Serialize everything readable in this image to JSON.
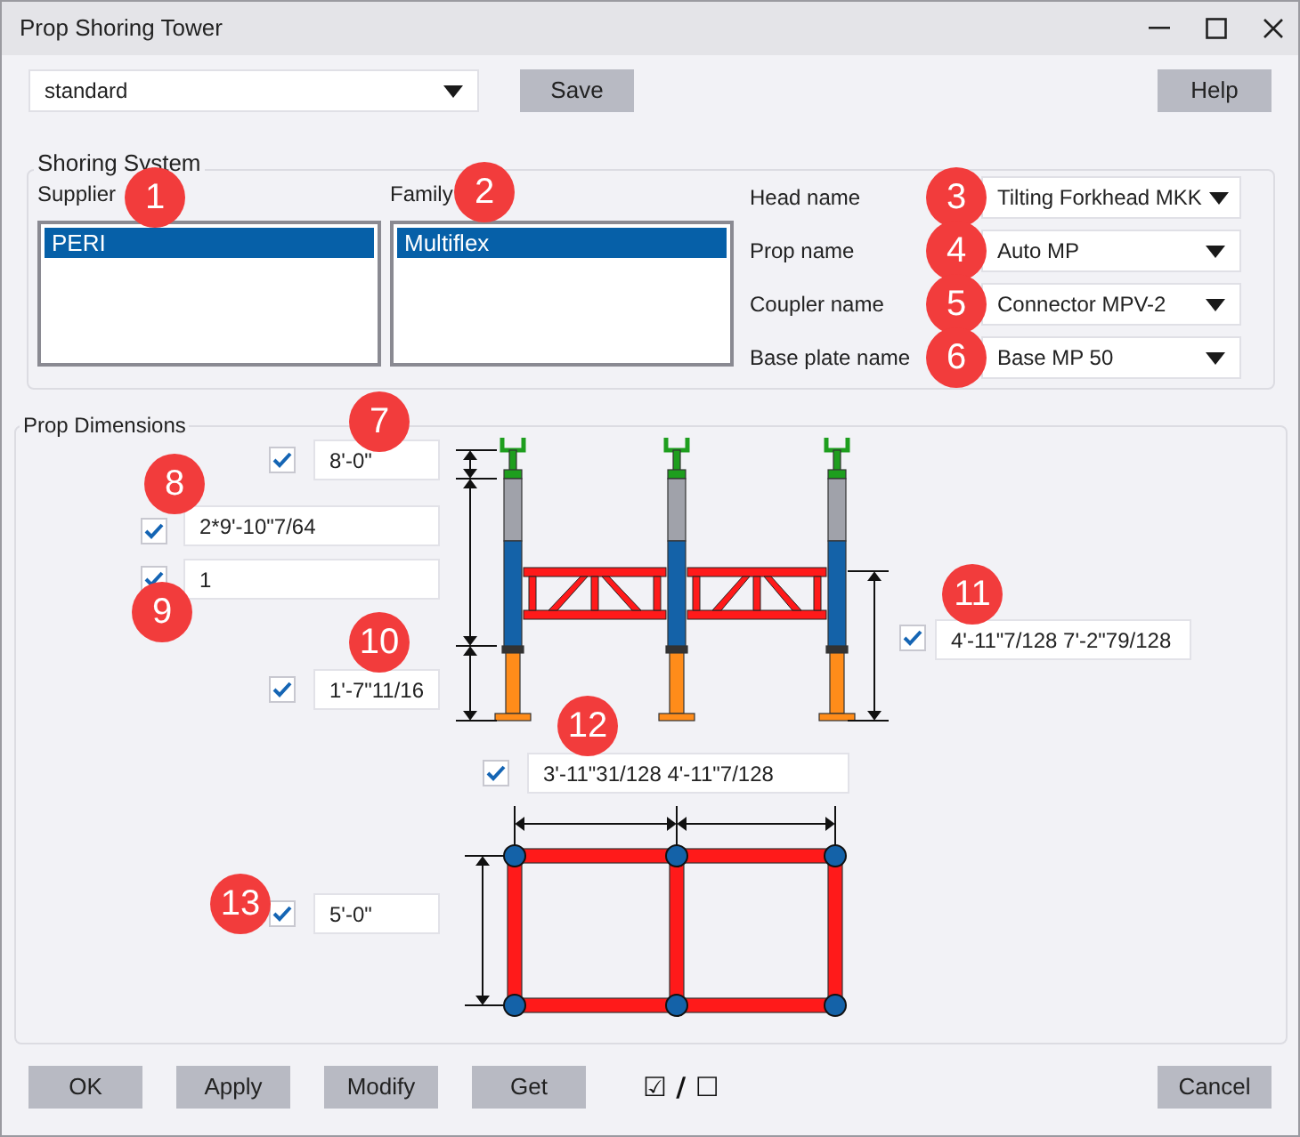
{
  "window": {
    "title": "Prop Shoring Tower"
  },
  "preset": {
    "value": "standard"
  },
  "top_buttons": [
    "Save",
    "Help"
  ],
  "shoring_system": {
    "label": "Shoring System",
    "lists": [
      {
        "label": "Supplier",
        "items": [
          {
            "text": "PERI",
            "selected": true
          }
        ]
      },
      {
        "label": "Family",
        "items": [
          {
            "text": "Multiflex",
            "selected": true
          }
        ]
      }
    ],
    "fields": [
      {
        "label": "Head name",
        "value": "Tilting Forkhead MKK"
      },
      {
        "label": "Prop name",
        "value": "Auto MP"
      },
      {
        "label": "Coupler name",
        "value": "Connector MPV-2"
      },
      {
        "label": "Base plate name",
        "value": "Base MP 50"
      }
    ]
  },
  "prop_dimensions": {
    "label": "Prop Dimensions",
    "fields": [
      {
        "checked": true,
        "value": "8'-0\""
      },
      {
        "checked": true,
        "value": "2*9'-10\"7/64"
      },
      {
        "checked": true,
        "value": "1"
      },
      {
        "checked": true,
        "value": "1'-7\"11/16"
      },
      {
        "checked": true,
        "value": "4'-11\"7/128 7'-2\"79/128"
      },
      {
        "checked": true,
        "value": "3'-11\"31/128 4'-11\"7/128"
      },
      {
        "checked": true,
        "value": "5'-0\""
      }
    ]
  },
  "callouts": [
    "1",
    "2",
    "3",
    "4",
    "5",
    "6",
    "7",
    "8",
    "9",
    "10",
    "11",
    "12",
    "13"
  ],
  "bottom_buttons": [
    {
      "kind": "button",
      "text": "OK"
    },
    {
      "kind": "button",
      "text": "Apply"
    },
    {
      "kind": "button",
      "text": "Modify"
    },
    {
      "kind": "button",
      "text": "Get"
    },
    {
      "kind": "toggle",
      "text": "☑ / ☐"
    },
    {
      "kind": "button",
      "text": "Cancel"
    }
  ]
}
